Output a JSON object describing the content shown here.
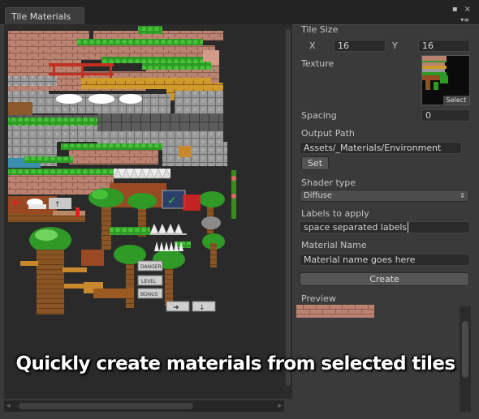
{
  "window": {
    "tab_title": "Tile Materials",
    "menu_icon": "kebab-menu-icon",
    "maximize_icon": "maximize-icon"
  },
  "tile_size": {
    "label": "Tile Size",
    "x_label": "X",
    "x_value": "16",
    "y_label": "Y",
    "y_value": "16"
  },
  "texture": {
    "label": "Texture",
    "select_label": "Select"
  },
  "spacing": {
    "label": "Spacing",
    "value": "0"
  },
  "output_path": {
    "label": "Output Path",
    "value": "Assets/_Materials/Environment",
    "set_label": "Set"
  },
  "shader": {
    "label": "Shader type",
    "value": "Diffuse"
  },
  "labels": {
    "label": "Labels to apply",
    "value": "space separated labels"
  },
  "material": {
    "label": "Material Name",
    "placeholder": "Material name goes here"
  },
  "create_label": "Create",
  "preview_label": "Preview",
  "caption": "Quickly create materials from selected tiles",
  "tilesheet_signs": [
    "DANGER",
    "LEVEL",
    "BONUS"
  ],
  "colors": {
    "accent": "#2c8c1e",
    "brick": "#b87a66",
    "dirt": "#8a5a2a"
  }
}
